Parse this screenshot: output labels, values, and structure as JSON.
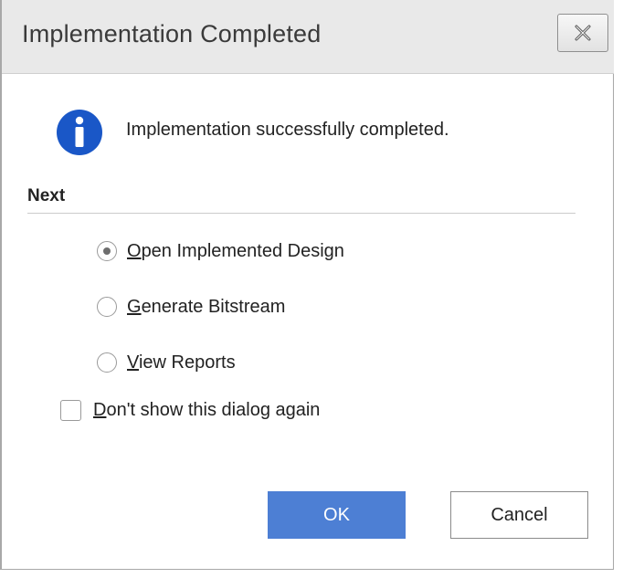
{
  "window": {
    "title": "Implementation Completed",
    "close_icon": "close-icon"
  },
  "message": {
    "icon": "info-icon",
    "text": "Implementation successfully completed."
  },
  "next": {
    "label": "Next",
    "options": [
      {
        "mnemonic": "O",
        "rest": "pen Implemented Design",
        "selected": true
      },
      {
        "mnemonic": "G",
        "rest": "enerate Bitstream",
        "selected": false
      },
      {
        "mnemonic": "V",
        "rest": "iew Reports",
        "selected": false
      }
    ]
  },
  "dont_show": {
    "mnemonic": "D",
    "rest": "on't show this dialog again",
    "checked": false
  },
  "buttons": {
    "ok_label": "OK",
    "cancel_label": "Cancel"
  },
  "colors": {
    "accent": "#4d7fd4",
    "info_icon": "#1a57c7",
    "titlebar_bg": "#e9e9e9"
  }
}
